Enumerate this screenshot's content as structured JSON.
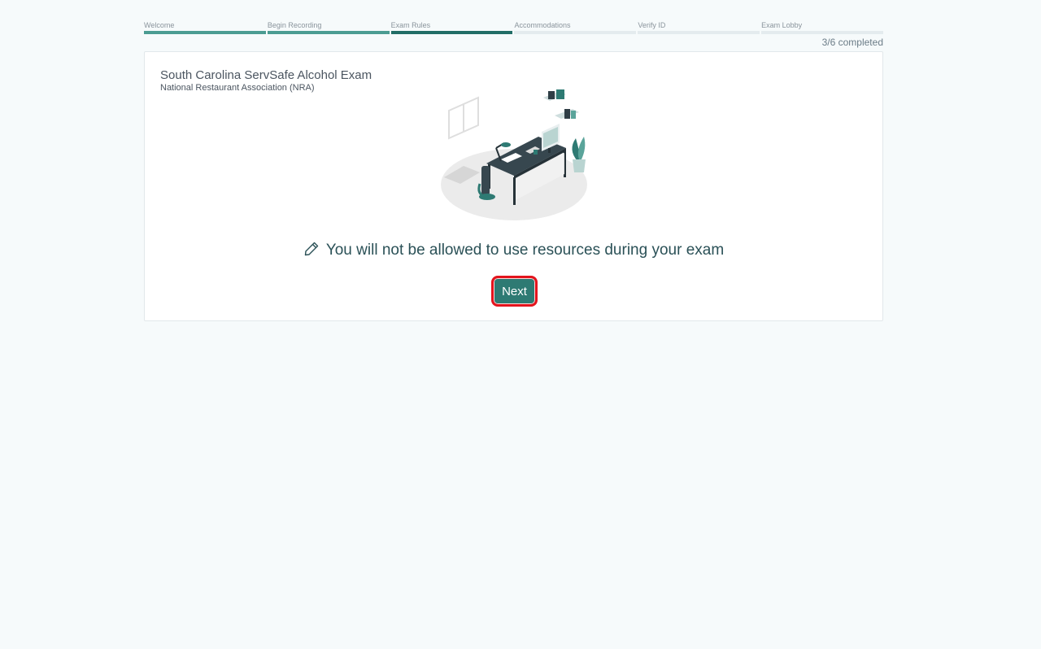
{
  "steps": [
    {
      "label": "Welcome",
      "state": "done"
    },
    {
      "label": "Begin Recording",
      "state": "done"
    },
    {
      "label": "Exam Rules",
      "state": "current"
    },
    {
      "label": "Accommodations",
      "state": "pending"
    },
    {
      "label": "Verify ID",
      "state": "pending"
    },
    {
      "label": "Exam Lobby",
      "state": "pending"
    }
  ],
  "progress": {
    "text": "3/6 completed",
    "completed": 3,
    "total": 6
  },
  "exam": {
    "title": "South Carolina ServSafe Alcohol Exam",
    "organization": "National Restaurant Association (NRA)"
  },
  "rule": {
    "icon": "pencil-icon",
    "text": "You will not be allowed to use resources during your exam"
  },
  "actions": {
    "next_label": "Next"
  },
  "colors": {
    "accent": "#2e7a73",
    "step_done": "#4b9c92",
    "step_current": "#216d66",
    "highlight": "#e3141d"
  }
}
